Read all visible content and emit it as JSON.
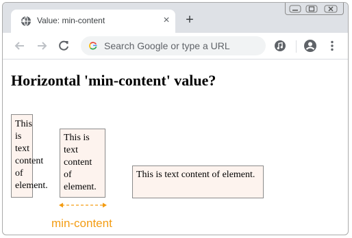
{
  "browser": {
    "tab_title": "Value: min-content",
    "tab_close_glyph": "×",
    "new_tab_glyph": "+",
    "omnibox_placeholder": "Search Google or type a URL",
    "icons": [
      "globe-icon",
      "back-arrow-icon",
      "forward-arrow-icon",
      "reload-icon",
      "google-g-icon",
      "media-icon",
      "profile-icon",
      "menu-dots-icon",
      "minimize-icon",
      "maximize-icon",
      "close-window-icon"
    ]
  },
  "page": {
    "heading": "Horizontal 'min-content' value?",
    "box1_text": "This is text content of element.",
    "box2_text": "This is text content of element.",
    "box3_text": "This is text content of element.",
    "annotation": "min-content",
    "colors": {
      "box_background": "#fdf3ee",
      "box_border": "#8a8a8a",
      "annotation": "#f39c12"
    }
  }
}
